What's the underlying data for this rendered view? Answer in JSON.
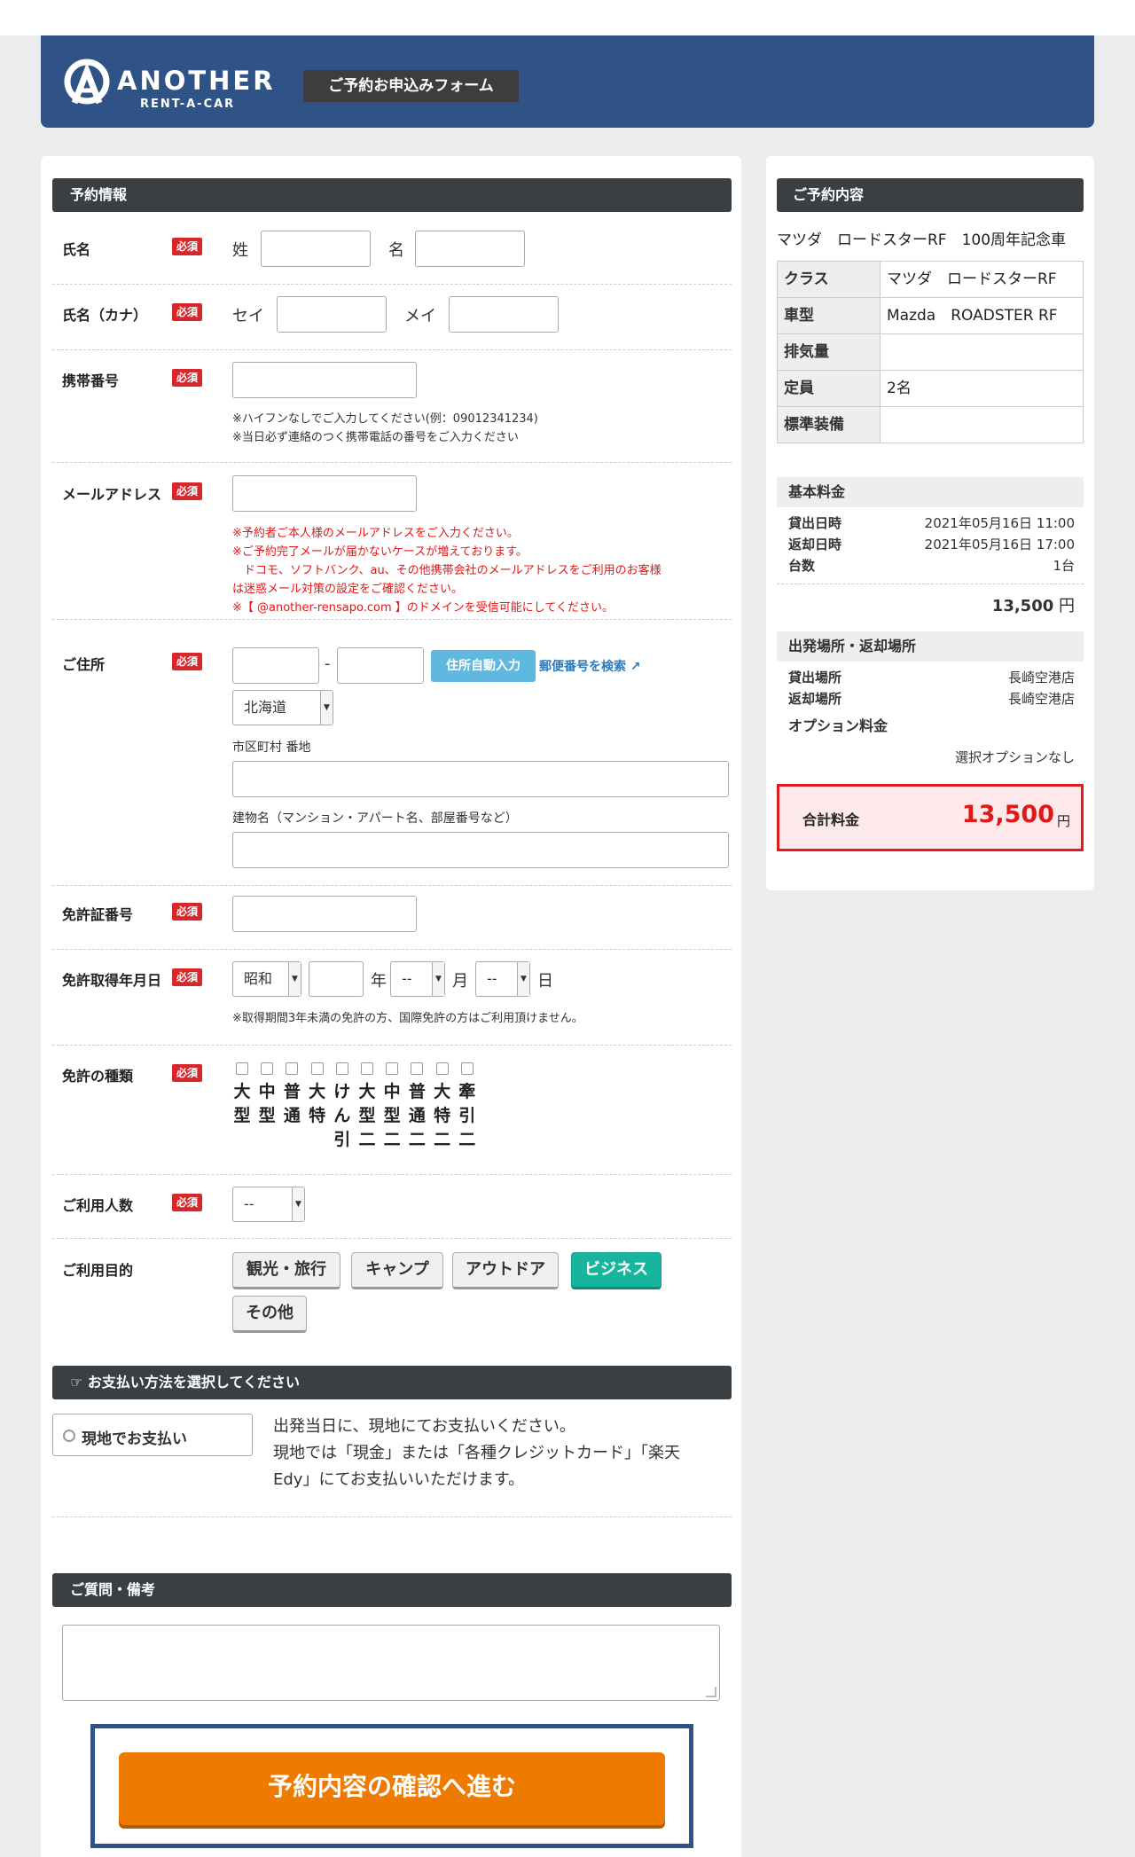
{
  "header": {
    "brand": "ANOTHER",
    "brand_sub": "RENT-A-CAR",
    "form_title": "ご予約お申込みフォーム"
  },
  "form": {
    "section_reservation": "予約情報",
    "required_badge": "必須",
    "name": {
      "label": "氏名",
      "last": "姓",
      "first": "名"
    },
    "kana": {
      "label": "氏名（カナ）",
      "last": "セイ",
      "first": "メイ"
    },
    "mobile": {
      "label": "携帯番号",
      "notes": [
        "※ハイフンなしでご入力してください(例：09012341234)",
        "※当日必ず連絡のつく携帯電話の番号をご入力ください"
      ]
    },
    "email": {
      "label": "メールアドレス",
      "notes": [
        "※予約者ご本人様のメールアドレスをご入力ください。",
        "※ご予約完了メールが届かないケースが増えております。",
        "　ドコモ、ソフトバンク、au、その他携帯会社のメールアドレスをご利用のお客様",
        "は迷惑メール対策の設定をご確認ください。",
        "※【 @another-rensapo.com 】のドメインを受信可能にしてください。"
      ]
    },
    "address": {
      "label": "ご住所",
      "zip_sep": "-",
      "auto_button": "住所自動入力",
      "zip_search_link": "郵便番号を検索",
      "prefecture": "北海道",
      "city_label": "市区町村 番地",
      "building_label": "建物名（マンション・アパート名、部屋番号など）"
    },
    "license_no": {
      "label": "免許証番号"
    },
    "license_date": {
      "label": "免許取得年月日",
      "era": "昭和",
      "year_unit": "年",
      "month": "--",
      "month_unit": "月",
      "day": "--",
      "day_unit": "日",
      "note": "※取得期間3年未満の免許の方、国際免許の方はご利用頂けません。"
    },
    "license_types": {
      "label": "免許の種類",
      "items": [
        [
          "大",
          "型"
        ],
        [
          "中",
          "型"
        ],
        [
          "普",
          "通"
        ],
        [
          "大",
          "特"
        ],
        [
          "け",
          "ん",
          "引"
        ],
        [
          "大",
          "型",
          "二"
        ],
        [
          "中",
          "型",
          "二"
        ],
        [
          "普",
          "通",
          "二"
        ],
        [
          "大",
          "特",
          "二"
        ],
        [
          "牽",
          "引",
          "二"
        ]
      ]
    },
    "people": {
      "label": "ご利用人数",
      "value": "--"
    },
    "purpose": {
      "label": "ご利用目的",
      "options": [
        "観光・旅行",
        "キャンプ",
        "アウトドア",
        "ビジネス",
        "その他"
      ],
      "selected": "ビジネス"
    },
    "payment": {
      "section": "お支払い方法を選択してください",
      "option": "現地でお支払い",
      "desc": [
        "出発当日に、現地にてお支払いください。",
        "現地では「現金」または「各種クレジットカード」「楽天",
        "Edy」にてお支払いいただけます。"
      ]
    },
    "questions": {
      "section": "ご質問・備考"
    },
    "submit": "予約内容の確認へ進む"
  },
  "summary": {
    "section": "ご予約内容",
    "car_title": "マツダ　ロードスターRF　100周年記念車",
    "spec": [
      {
        "k": "クラス",
        "v": "マツダ　ロードスターRF"
      },
      {
        "k": "車型",
        "v": "Mazda　ROADSTER RF"
      },
      {
        "k": "排気量",
        "v": ""
      },
      {
        "k": "定員",
        "v": "2名"
      },
      {
        "k": "標準装備",
        "v": ""
      }
    ],
    "base_fee": {
      "label": "基本料金",
      "pickup_k": "貸出日時",
      "pickup_v": "2021年05月16日 11:00",
      "return_k": "返却日時",
      "return_v": "2021年05月16日 17:00",
      "count_k": "台数",
      "count_v": "1台",
      "amount": "13,500",
      "yen": "円"
    },
    "places": {
      "label": "出発場所・返却場所",
      "pickup_k": "貸出場所",
      "pickup_v": "長崎空港店",
      "return_k": "返却場所",
      "return_v": "長崎空港店"
    },
    "options": {
      "label": "オプション料金",
      "value": "選択オプションなし"
    },
    "total": {
      "label": "合計料金",
      "amount": "13,500",
      "yen": "円"
    }
  },
  "colors": {
    "header": "#2f5386",
    "required": "#d9262a",
    "submit": "#ee7a00",
    "selected": "#17b59e",
    "total": "#e01818"
  }
}
